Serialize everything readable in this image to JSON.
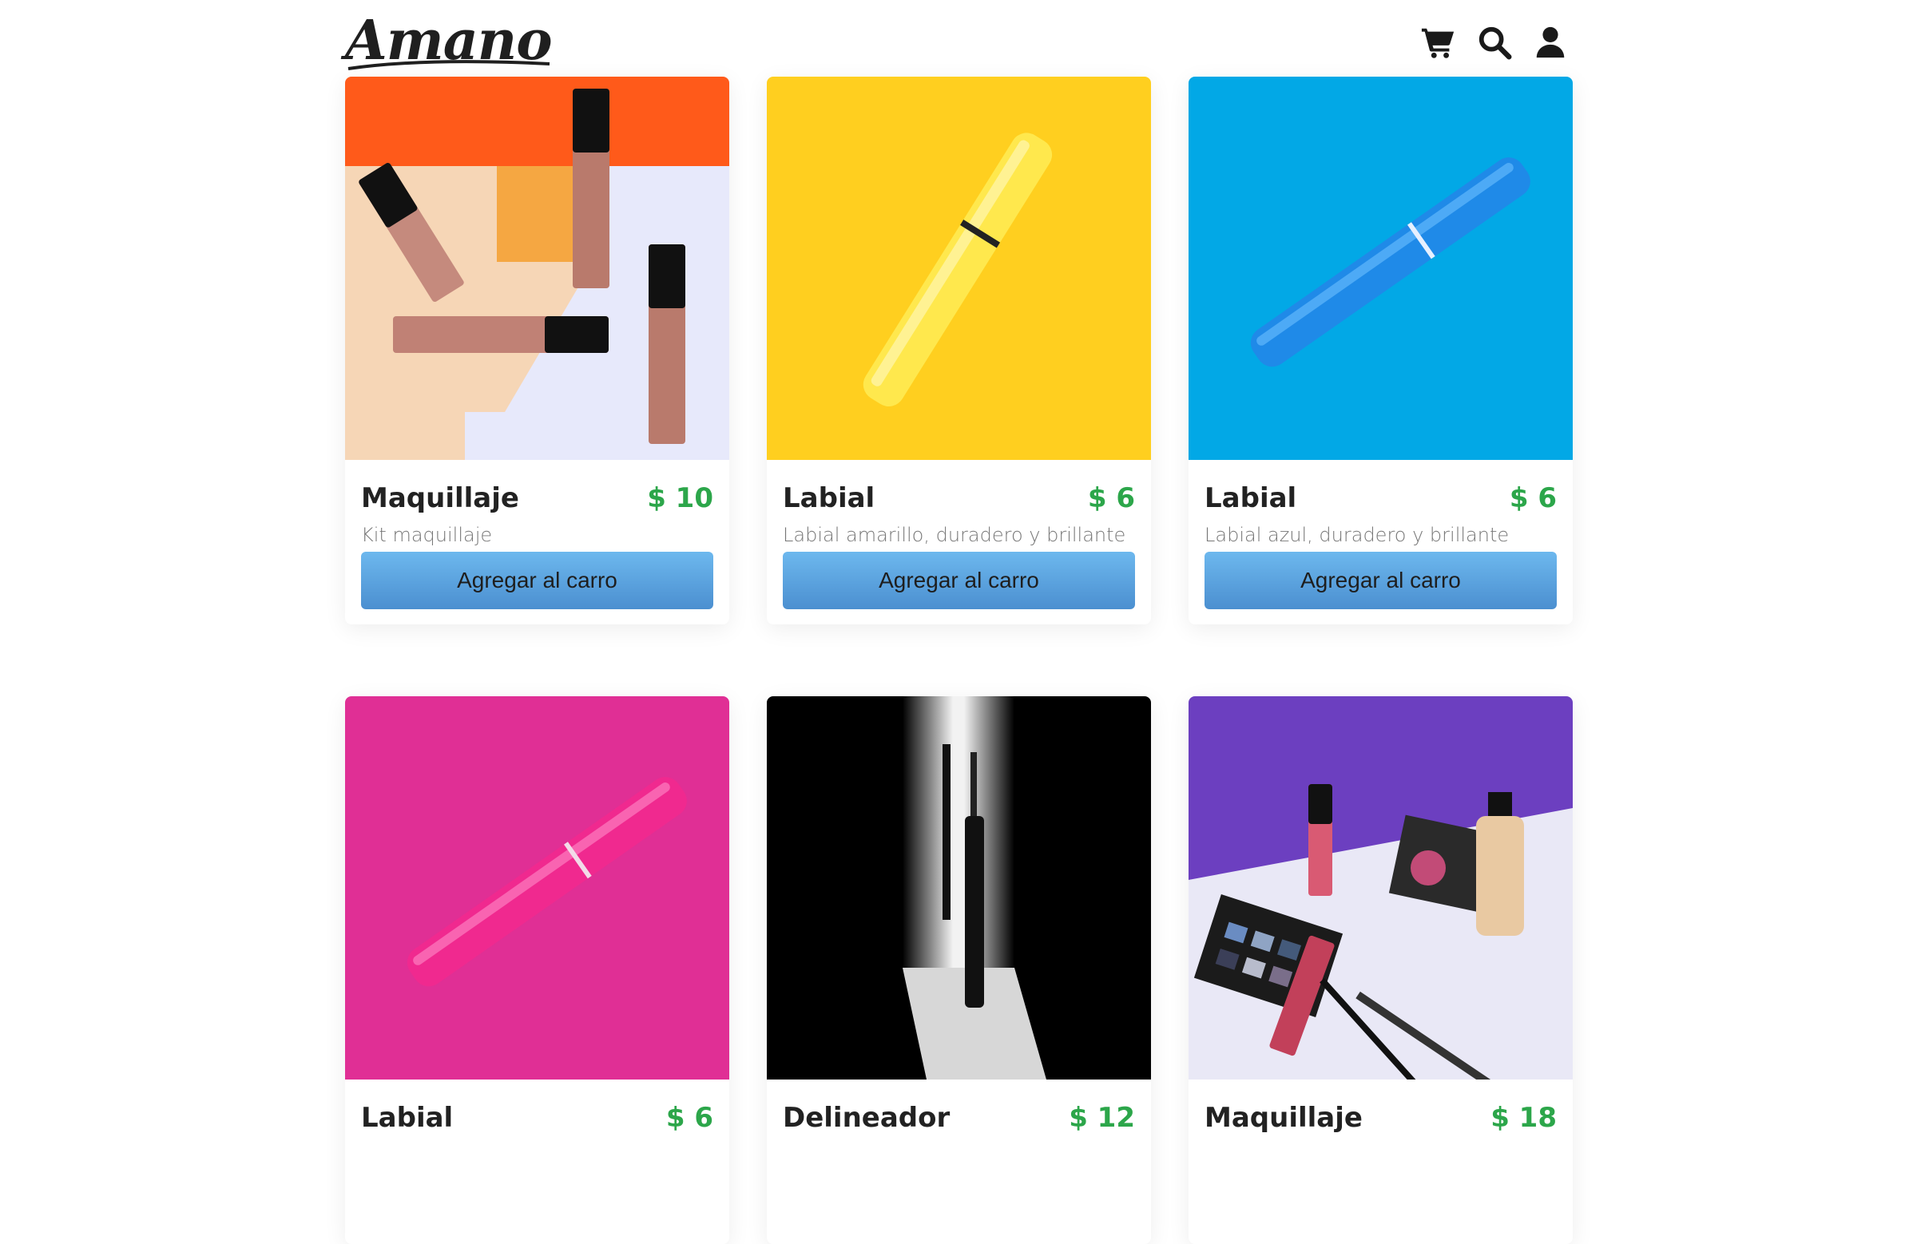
{
  "header": {
    "logo_text": "Amano",
    "icons": [
      "cart-icon",
      "search-icon",
      "user-icon"
    ]
  },
  "colors": {
    "price": "#2ca64a",
    "button_top": "#6db8ee",
    "button_bottom": "#4b8fd0"
  },
  "products": [
    {
      "title": "Maquillaje",
      "price": "$ 10",
      "description": "Kit maquillaje",
      "button": "Agregar al carro",
      "image": "lip-gloss-set-on-orange-white-background"
    },
    {
      "title": "Labial",
      "price": "$ 6",
      "description": "Labial amarillo, duradero y brillante",
      "button": "Agregar al carro",
      "image": "yellow-lipstick-on-yellow-background"
    },
    {
      "title": "Labial",
      "price": "$ 6",
      "description": "Labial azul, duradero y brillante",
      "button": "Agregar al carro",
      "image": "blue-lipstick-on-blue-background"
    },
    {
      "title": "Labial",
      "price": "$ 6",
      "image": "pink-lipstick-on-pink-background"
    },
    {
      "title": "Delineador",
      "price": "$ 12",
      "image": "eyeliner-in-light-beam"
    },
    {
      "title": "Maquillaje",
      "price": "$ 18",
      "image": "makeup-kit-on-purple-background"
    }
  ]
}
